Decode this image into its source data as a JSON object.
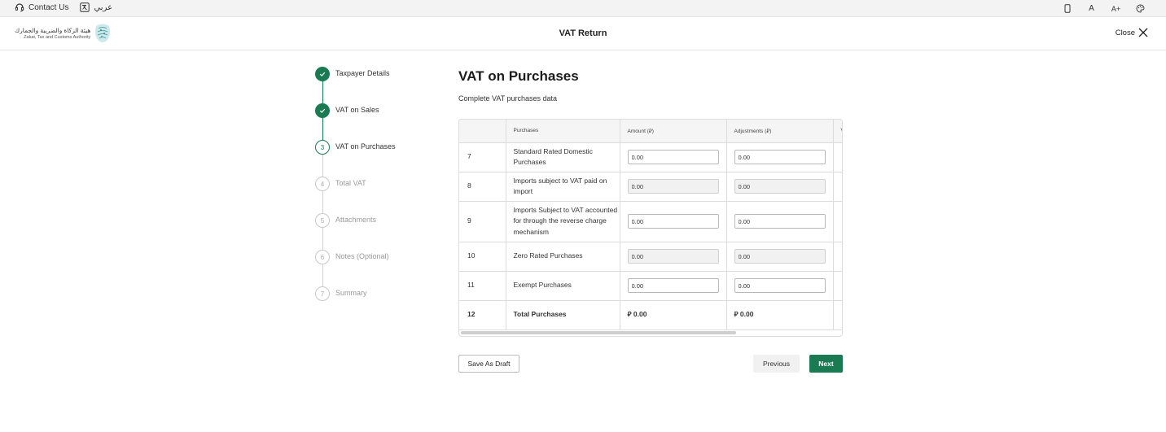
{
  "utility_bar": {
    "contact_label": "Contact Us",
    "language_label": "عربي",
    "contact_icon": "headset-icon",
    "language_icon": "translate-icon",
    "right_icons": [
      "device-icon",
      "font-decrease-icon",
      "font-increase-icon",
      "palette-icon"
    ],
    "font_small_glyph": "A",
    "font_large_glyph": "A+"
  },
  "header": {
    "logo_arabic": "هيئة الزكاة والضريبة والجمارك",
    "logo_english": "Zakat, Tax and Customs Authority",
    "title": "VAT Return",
    "close_label": "Close"
  },
  "steps": [
    {
      "number": "1",
      "label": "Taxpayer Details",
      "state": "done"
    },
    {
      "number": "2",
      "label": "VAT on Sales",
      "state": "done"
    },
    {
      "number": "3",
      "label": "VAT on Purchases",
      "state": "current"
    },
    {
      "number": "4",
      "label": "Total VAT",
      "state": "todo"
    },
    {
      "number": "5",
      "label": "Attachments",
      "state": "todo"
    },
    {
      "number": "6",
      "label": "Notes (Optional)",
      "state": "todo"
    },
    {
      "number": "7",
      "label": "Summary",
      "state": "todo"
    }
  ],
  "main": {
    "title": "VAT on Purchases",
    "subtitle": "Complete VAT purchases data"
  },
  "table": {
    "headers": {
      "index": "",
      "purchases": "Purchases",
      "amount": "Amount (⃁)",
      "adjustments": "Adjustments (⃁)",
      "vat": "V"
    },
    "rows": [
      {
        "num": "7",
        "desc": "Standard Rated Domestic Purchases",
        "amount": "0.00",
        "adjustment": "0.00",
        "disabled": false
      },
      {
        "num": "8",
        "desc": "Imports subject to VAT paid on import",
        "amount": "0.00",
        "adjustment": "0.00",
        "disabled": true
      },
      {
        "num": "9",
        "desc": "Imports Subject to VAT accounted for through the reverse charge mechanism",
        "amount": "0.00",
        "adjustment": "0.00",
        "disabled": false
      },
      {
        "num": "10",
        "desc": "Zero Rated Purchases",
        "amount": "0.00",
        "adjustment": "0.00",
        "disabled": true
      },
      {
        "num": "11",
        "desc": "Exempt Purchases",
        "amount": "0.00",
        "adjustment": "0.00",
        "disabled": false
      }
    ],
    "total": {
      "num": "12",
      "desc": "Total Purchases",
      "amount": "⃁ 0.00",
      "adjustment": "⃁ 0.00"
    }
  },
  "footer": {
    "save_draft": "Save As Draft",
    "previous": "Previous",
    "next": "Next"
  },
  "colors": {
    "accent": "#1a7a52",
    "border": "#dcdcdc"
  }
}
